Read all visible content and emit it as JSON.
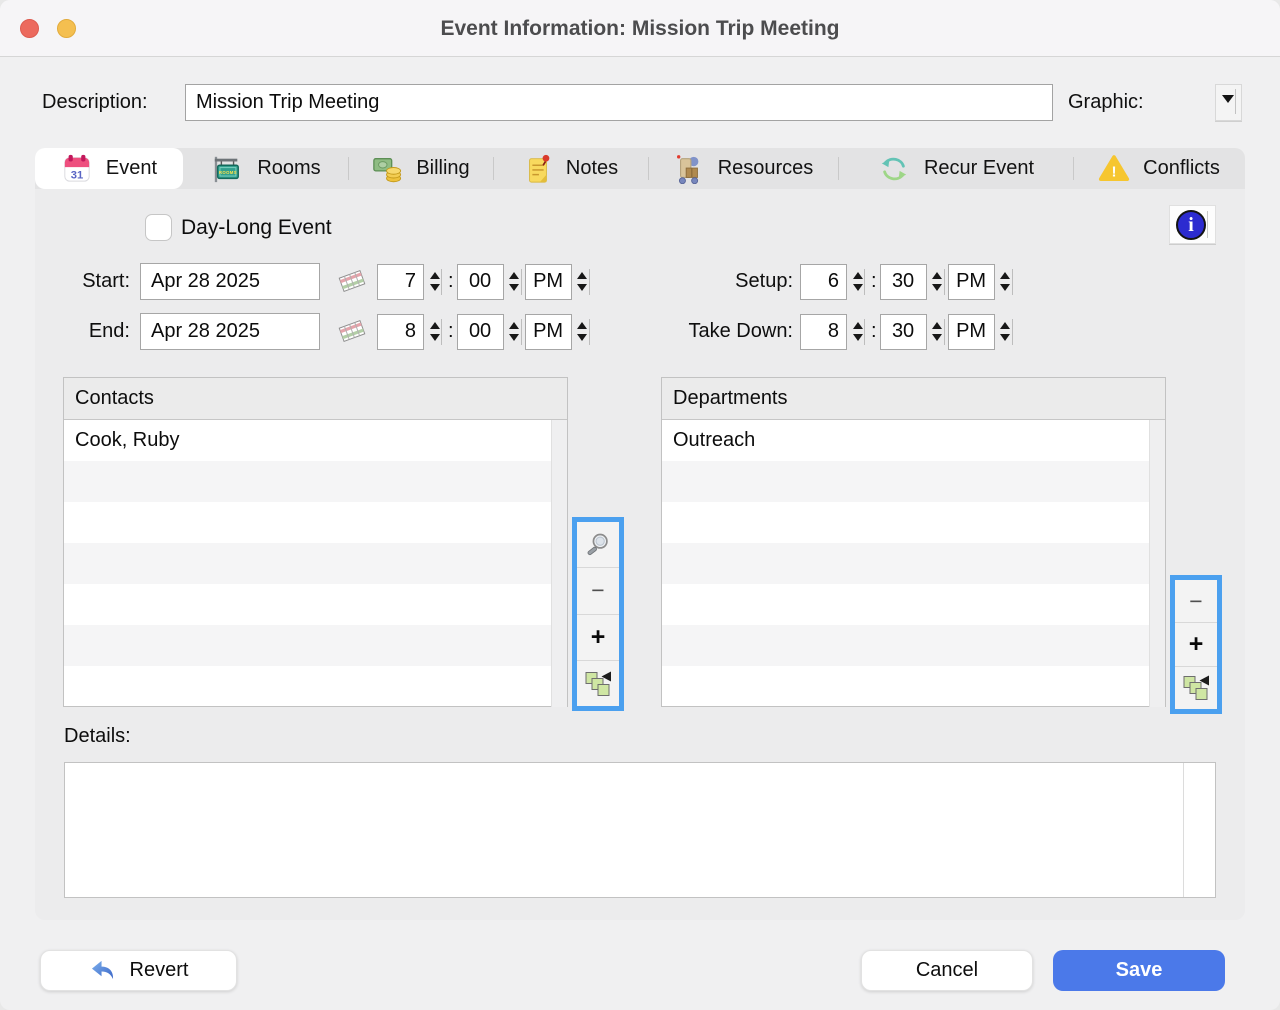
{
  "window": {
    "title": "Event Information: Mission Trip Meeting"
  },
  "header": {
    "description_label": "Description:",
    "description_value": "Mission Trip Meeting",
    "graphic_label": "Graphic:"
  },
  "tabs": [
    {
      "label": "Event",
      "icon": "calendar-31-icon",
      "selected": true
    },
    {
      "label": "Rooms",
      "icon": "rooms-sign-icon",
      "selected": false
    },
    {
      "label": "Billing",
      "icon": "money-coins-icon",
      "selected": false
    },
    {
      "label": "Notes",
      "icon": "notepad-pin-icon",
      "selected": false
    },
    {
      "label": "Resources",
      "icon": "hand-truck-icon",
      "selected": false
    },
    {
      "label": "Recur Event",
      "icon": "recur-arrows-icon",
      "selected": false
    },
    {
      "label": "Conflicts",
      "icon": "warning-triangle-icon",
      "selected": false
    }
  ],
  "event_tab": {
    "day_long_event": {
      "label": "Day-Long Event",
      "checked": false
    },
    "time_separator": ":",
    "start": {
      "label": "Start:",
      "date": "Apr 28 2025",
      "hour": "7",
      "minute": "00",
      "meridiem": "PM"
    },
    "end": {
      "label": "End:",
      "date": "Apr 28 2025",
      "hour": "8",
      "minute": "00",
      "meridiem": "PM"
    },
    "setup": {
      "label": "Setup:",
      "hour": "6",
      "minute": "30",
      "meridiem": "PM"
    },
    "take_down": {
      "label": "Take Down:",
      "hour": "8",
      "minute": "30",
      "meridiem": "PM"
    },
    "contacts": {
      "header": "Contacts",
      "rows": [
        "Cook, Ruby"
      ]
    },
    "departments": {
      "header": "Departments",
      "rows": [
        "Outreach"
      ]
    },
    "details_label": "Details:"
  },
  "toolbars": {
    "minus_label": "−",
    "plus_label": "+",
    "contacts_buttons": [
      "magnifier-icon",
      "remove-button",
      "add-button",
      "pick-items-icon"
    ],
    "departments_buttons": [
      "remove-button",
      "add-button",
      "pick-items-icon"
    ]
  },
  "footer": {
    "revert_label": "Revert",
    "cancel_label": "Cancel",
    "save_label": "Save"
  },
  "colors": {
    "highlight_blue": "#4ba0ef",
    "save_blue": "#4b79e9",
    "warning_yellow": "#f6c62f",
    "info_blue": "#2c2bd0",
    "titlebar_bg": "#f6f5f7",
    "panel_bg": "#ececed"
  }
}
